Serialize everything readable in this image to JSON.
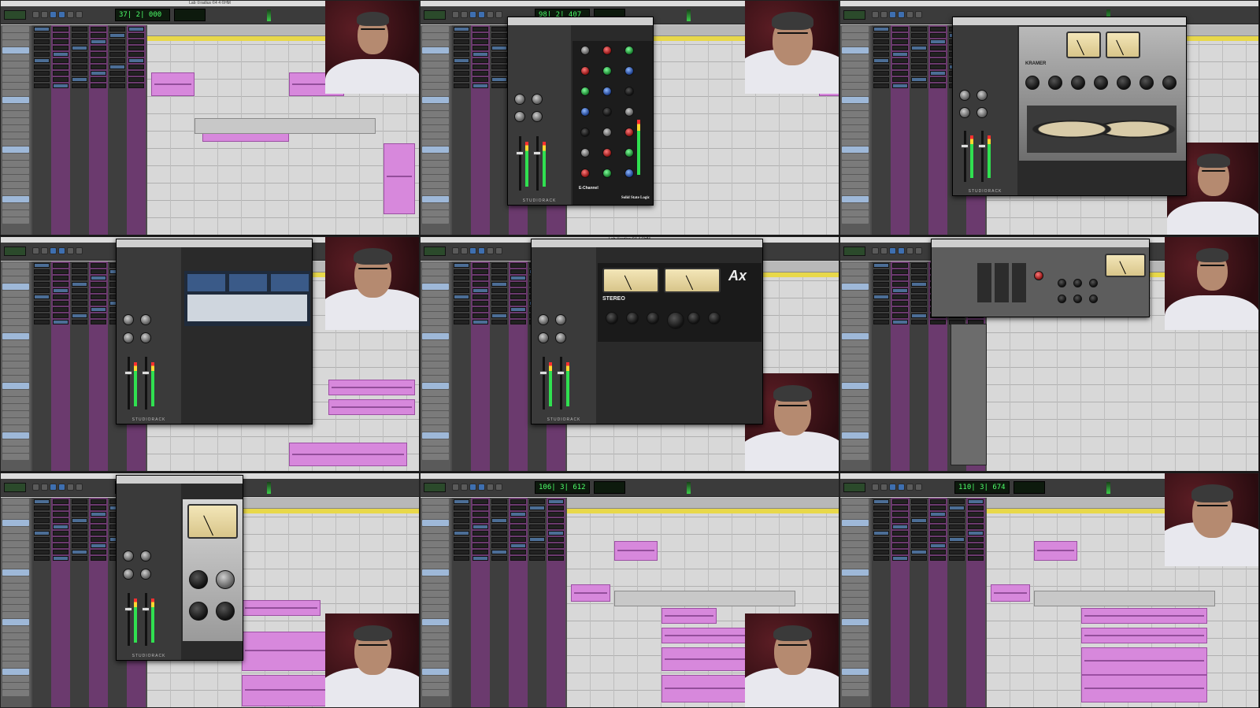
{
  "titles": {
    "p1": "Lab ①radius ©4 4 ©HM",
    "p5": "Lab ①radius ©4 4 ©HM"
  },
  "counters": {
    "p1": "37| 2| 000",
    "p2": "98| 2| 407",
    "p7": "",
    "p8": "106| 3| 612",
    "p9": "110| 3| 674"
  },
  "plugins": {
    "ssl": {
      "brand": "Solid State Logic",
      "model": "E-Channel"
    },
    "kramer": {
      "brand": "KRAMER"
    },
    "ax": {
      "name": "Ax",
      "mode": "STEREO"
    },
    "rack": "STUDIORACK"
  },
  "colors": {
    "clip": "#d788dc",
    "strip_purple": "#6b3a6e",
    "transport_green": "#4dff6a",
    "backdrop": "#5b1d24"
  },
  "icons": [
    "play-icon",
    "stop-icon",
    "record-icon",
    "rewind-icon",
    "forward-icon",
    "loop-icon"
  ]
}
